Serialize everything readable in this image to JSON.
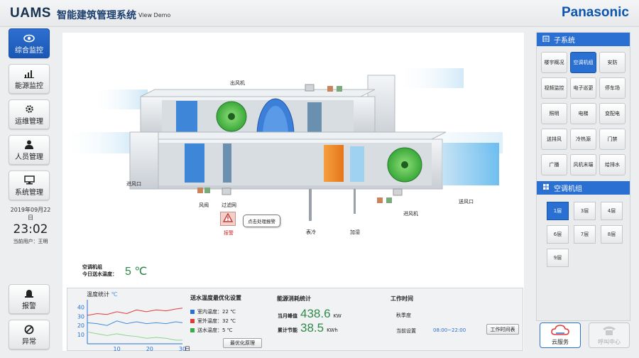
{
  "header": {
    "logo": "UAMS",
    "title": "智能建筑管理系统",
    "subtitle": "View Demo",
    "brand": "Panasonic"
  },
  "nav": {
    "items": [
      {
        "label": "综合监控",
        "icon": "eye-icon",
        "active": true
      },
      {
        "label": "能源监控",
        "icon": "bar-chart-icon",
        "active": false
      },
      {
        "label": "运维管理",
        "icon": "gear-icon",
        "active": false
      },
      {
        "label": "人员管理",
        "icon": "user-icon",
        "active": false
      },
      {
        "label": "系统管理",
        "icon": "monitor-icon",
        "active": false
      }
    ]
  },
  "status": {
    "date": "2019年09月22日",
    "time": "23:02",
    "user": "当前用户：王明"
  },
  "bottom_nav": [
    {
      "label": "报警",
      "icon": "alarm-bell-icon"
    },
    {
      "label": "异常",
      "icon": "prohibited-icon"
    }
  ],
  "diagram": {
    "labels": {
      "exhaust_fan": "出风机",
      "inlet": "进风口",
      "damper": "风阀",
      "filter": "过滤网",
      "cooling": "表冷",
      "humidify": "加湿",
      "supply_fan": "进风机",
      "outlet": "送风口"
    },
    "alarm": {
      "label": "报警",
      "tooltip": "点击处理报警"
    },
    "supply_temp": {
      "title": "空调机组",
      "label": "今日送水温度：",
      "value": "5 ℃"
    }
  },
  "temp_chart": {
    "title": "温度统计",
    "unit": "℃",
    "xlabel": "日期",
    "y_ticks": [
      "40",
      "30",
      "20",
      "10"
    ],
    "x_ticks": [
      "10",
      "20",
      "30"
    ]
  },
  "chart_data": {
    "type": "line",
    "title": "温度统计",
    "xlabel": "日期",
    "ylabel": "℃",
    "ylim": [
      0,
      45
    ],
    "xlim": [
      1,
      30
    ],
    "series": [
      {
        "color": "#e23a3a",
        "x": [
          1,
          4,
          7,
          10,
          13,
          16,
          19,
          22,
          25,
          28,
          30
        ],
        "y": [
          31,
          33,
          32,
          35,
          33,
          37,
          35,
          37,
          36,
          38,
          39
        ]
      },
      {
        "color": "#3f8fd6",
        "x": [
          1,
          4,
          7,
          10,
          13,
          16,
          19,
          22,
          25,
          28,
          30
        ],
        "y": [
          23,
          22,
          20,
          25,
          22,
          24,
          22,
          23,
          22,
          24,
          23
        ]
      },
      {
        "color": "#8fd48f",
        "x": [
          1,
          4,
          7,
          10,
          13,
          16,
          19,
          22,
          25,
          28,
          30
        ],
        "y": [
          13,
          11,
          9,
          11,
          9,
          8,
          6,
          7,
          6,
          4,
          4
        ]
      }
    ]
  },
  "optimize": {
    "title": "送水温度最优化设置",
    "rows": [
      {
        "label": "室内温度：22 ℃",
        "color": "#2a6fd2"
      },
      {
        "label": "室外温度：32 ℃",
        "color": "#e23a3a"
      },
      {
        "label": "送水温度：5  ℃",
        "color": "#3aaa4a"
      }
    ],
    "button": "最优化原理"
  },
  "energy": {
    "title": "能源消耗统计",
    "peak_label": "当月峰值",
    "peak_value": "438.6",
    "peak_unit": "KW",
    "saving_label": "累计节能",
    "saving_value": "38.5",
    "saving_unit": "KWh"
  },
  "worktime": {
    "title": "工作时间",
    "season": "秋季度",
    "setting_label": "当前设置",
    "setting_value": "08:00~22:00",
    "button": "工作时间表"
  },
  "subsystems": {
    "title": "子系统",
    "items": [
      "楼宇概况",
      "空调机组",
      "安防",
      "视频监控",
      "电子巡更",
      "停车场",
      "照明",
      "电梯",
      "变配电",
      "送排风",
      "冷热源",
      "门禁",
      "广播",
      "风机末端",
      "给排水"
    ],
    "active_index": 1
  },
  "ahu": {
    "title": "空调机组",
    "floors": [
      "1层",
      "3层",
      "4层",
      "6层",
      "7层",
      "8层",
      "9层"
    ],
    "active_index": 0
  },
  "footer_buttons": [
    {
      "label": "云服务",
      "icon": "cloud-icon"
    },
    {
      "label": "呼叫中心",
      "icon": "phone-icon"
    }
  ]
}
